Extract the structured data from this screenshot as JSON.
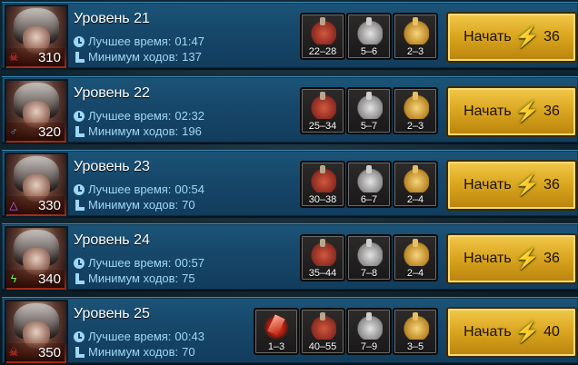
{
  "labels": {
    "best_time": "Лучшее время:",
    "min_moves": "Минимум ходов:",
    "start": "Начать"
  },
  "colors": {
    "row": "#16476a",
    "stat_text": "#9fd8f5",
    "button": "#d9a41e",
    "energy": "#b8ff3c"
  },
  "levels": [
    {
      "title": "Уровень 21",
      "power": "310",
      "affinity_icon": "skull-icon",
      "best_time": "01:47",
      "min_moves": "137",
      "energy": "36",
      "rewards": [
        {
          "type": "red-potion-icon",
          "range": "22–28"
        },
        {
          "type": "silver-potion-icon",
          "range": "5–6"
        },
        {
          "type": "gold-potion-icon",
          "range": "2–3"
        }
      ]
    },
    {
      "title": "Уровень 22",
      "power": "320",
      "affinity_icon": "magic-icon",
      "best_time": "02:32",
      "min_moves": "196",
      "energy": "36",
      "rewards": [
        {
          "type": "red-potion-icon",
          "range": "25–34"
        },
        {
          "type": "silver-potion-icon",
          "range": "5–7"
        },
        {
          "type": "gold-potion-icon",
          "range": "2–3"
        }
      ]
    },
    {
      "title": "Уровень 23",
      "power": "330",
      "affinity_icon": "triangle-icon",
      "best_time": "00:54",
      "min_moves": "70",
      "energy": "36",
      "rewards": [
        {
          "type": "red-potion-icon",
          "range": "30–38"
        },
        {
          "type": "silver-potion-icon",
          "range": "6–7"
        },
        {
          "type": "gold-potion-icon",
          "range": "2–4"
        }
      ]
    },
    {
      "title": "Уровень 24",
      "power": "340",
      "affinity_icon": "lightning-icon",
      "best_time": "00:57",
      "min_moves": "75",
      "energy": "36",
      "rewards": [
        {
          "type": "red-potion-icon",
          "range": "35–44"
        },
        {
          "type": "silver-potion-icon",
          "range": "7–8"
        },
        {
          "type": "gold-potion-icon",
          "range": "2–4"
        }
      ]
    },
    {
      "title": "Уровень 25",
      "power": "350",
      "affinity_icon": "skull-icon",
      "best_time": "00:43",
      "min_moves": "70",
      "energy": "40",
      "rewards": [
        {
          "type": "red-shard-icon",
          "range": "1–3"
        },
        {
          "type": "red-potion-icon",
          "range": "40–55"
        },
        {
          "type": "silver-potion-icon",
          "range": "7–9"
        },
        {
          "type": "gold-potion-icon",
          "range": "3–5"
        }
      ]
    }
  ]
}
